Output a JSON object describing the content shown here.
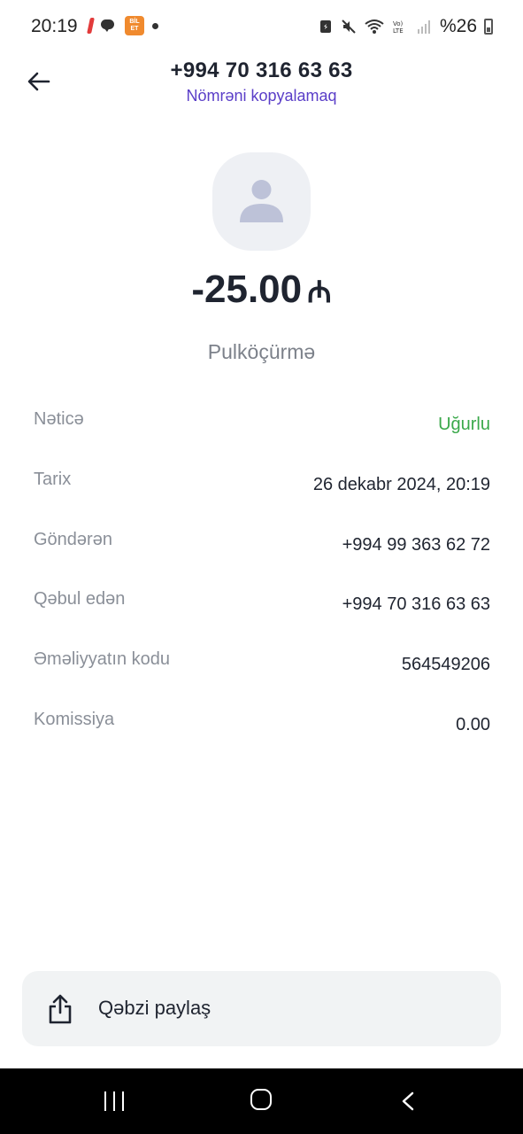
{
  "status_bar": {
    "time": "20:19",
    "app_icon_text": "BİLET\nTEXT",
    "battery": "%26"
  },
  "header": {
    "title": "+994 70 316 63 63",
    "subtitle": "Nömrəni kopyalamaq"
  },
  "transfer": {
    "amount": "-25.00",
    "currency": "₼",
    "type": "Pulköçürmə"
  },
  "details": [
    {
      "label": "Nəticə",
      "value": "Uğurlu"
    },
    {
      "label": "Tarix",
      "value": "26 dekabr 2024, 20:19"
    },
    {
      "label": "Göndərən",
      "value": "+994 99 363 62 72"
    },
    {
      "label": "Qəbul edən",
      "value": "+994 70 316 63 63"
    },
    {
      "label": "Əməliyyatın kodu",
      "value": "564549206"
    },
    {
      "label": "Komissiya",
      "value": "0.00"
    }
  ],
  "share_button": {
    "label": "Qəbzi paylaş"
  },
  "colors": {
    "accent": "#5a3ec8",
    "success": "#3aa84a",
    "text": "#1f2430",
    "muted": "#8a8f98"
  },
  "icons": {
    "back": "arrow-left-icon",
    "avatar": "person-icon",
    "share": "share-icon"
  }
}
